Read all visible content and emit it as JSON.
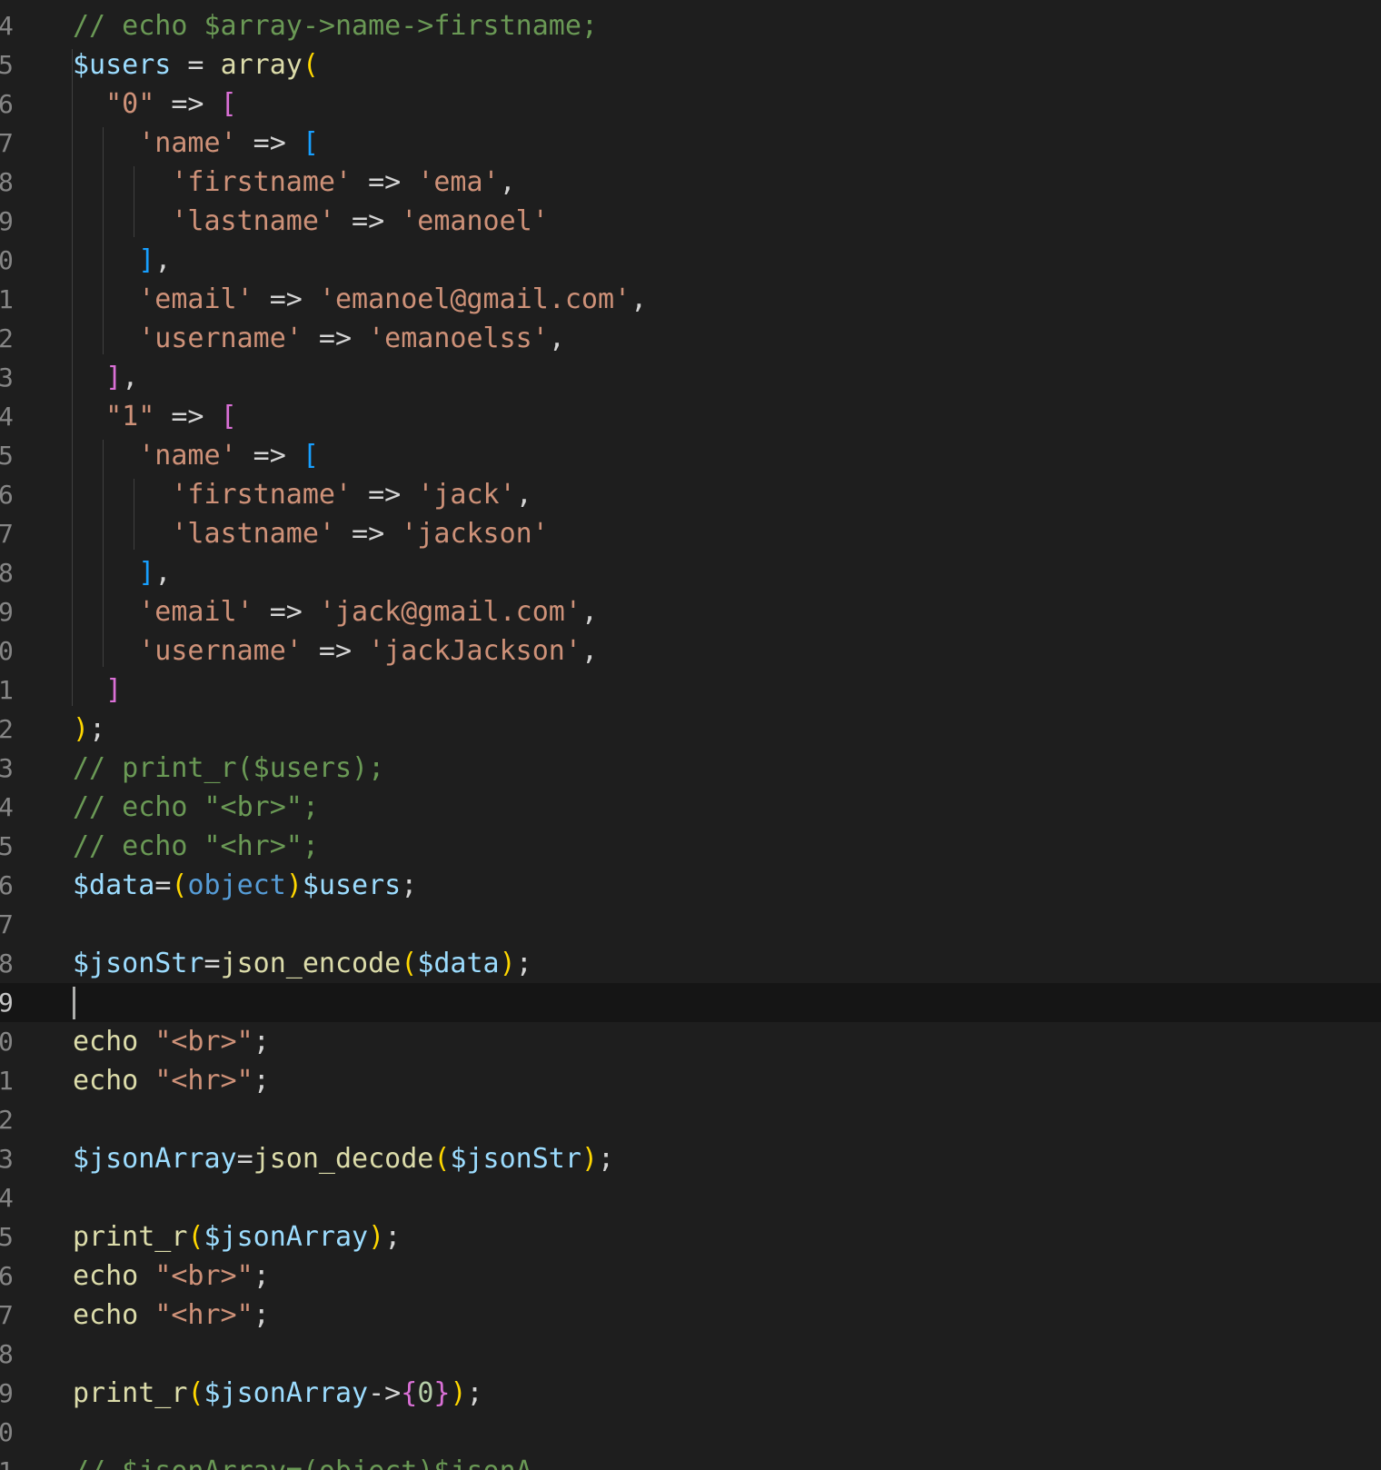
{
  "editor": {
    "colors": {
      "background": "#1e1e1e",
      "current_line": "#151515",
      "line_number": "#858585",
      "comment": "#6a9955",
      "variable": "#9cdcfe",
      "function": "#dcdcaa",
      "string": "#ce9178",
      "keyword": "#569cd6",
      "bracket_level1": "#ffd700",
      "bracket_level2": "#da70d6",
      "bracket_level3": "#179fff"
    },
    "current_line_number": "9",
    "lines": [
      {
        "n": "4",
        "tokens": [
          [
            "comment",
            "// echo $array->name->firstname;"
          ]
        ]
      },
      {
        "n": "5",
        "tokens": [
          [
            "var",
            "$users"
          ],
          [
            "op",
            " = "
          ],
          [
            "fn",
            "array"
          ],
          [
            "b1",
            "("
          ]
        ]
      },
      {
        "n": "6",
        "tokens": [
          [
            "plain",
            "  "
          ],
          [
            "str",
            "\"0\""
          ],
          [
            "op",
            " => "
          ],
          [
            "b2",
            "["
          ]
        ]
      },
      {
        "n": "7",
        "tokens": [
          [
            "plain",
            "    "
          ],
          [
            "str",
            "'name'"
          ],
          [
            "op",
            " => "
          ],
          [
            "b3",
            "["
          ]
        ]
      },
      {
        "n": "8",
        "tokens": [
          [
            "plain",
            "      "
          ],
          [
            "str",
            "'firstname'"
          ],
          [
            "op",
            " => "
          ],
          [
            "str",
            "'ema'"
          ],
          [
            "punc",
            ","
          ]
        ]
      },
      {
        "n": "9",
        "tokens": [
          [
            "plain",
            "      "
          ],
          [
            "str",
            "'lastname'"
          ],
          [
            "op",
            " => "
          ],
          [
            "str",
            "'emanoel'"
          ]
        ]
      },
      {
        "n": "0",
        "tokens": [
          [
            "plain",
            "    "
          ],
          [
            "b3",
            "]"
          ],
          [
            "punc",
            ","
          ]
        ]
      },
      {
        "n": "1",
        "tokens": [
          [
            "plain",
            "    "
          ],
          [
            "str",
            "'email'"
          ],
          [
            "op",
            " => "
          ],
          [
            "str",
            "'emanoel@gmail.com'"
          ],
          [
            "punc",
            ","
          ]
        ]
      },
      {
        "n": "2",
        "tokens": [
          [
            "plain",
            "    "
          ],
          [
            "str",
            "'username'"
          ],
          [
            "op",
            " => "
          ],
          [
            "str",
            "'emanoelss'"
          ],
          [
            "punc",
            ","
          ]
        ]
      },
      {
        "n": "3",
        "tokens": [
          [
            "plain",
            "  "
          ],
          [
            "b2",
            "]"
          ],
          [
            "punc",
            ","
          ]
        ]
      },
      {
        "n": "4",
        "tokens": [
          [
            "plain",
            "  "
          ],
          [
            "str",
            "\"1\""
          ],
          [
            "op",
            " => "
          ],
          [
            "b2",
            "["
          ]
        ]
      },
      {
        "n": "5",
        "tokens": [
          [
            "plain",
            "    "
          ],
          [
            "str",
            "'name'"
          ],
          [
            "op",
            " => "
          ],
          [
            "b3",
            "["
          ]
        ]
      },
      {
        "n": "6",
        "tokens": [
          [
            "plain",
            "      "
          ],
          [
            "str",
            "'firstname'"
          ],
          [
            "op",
            " => "
          ],
          [
            "str",
            "'jack'"
          ],
          [
            "punc",
            ","
          ]
        ]
      },
      {
        "n": "7",
        "tokens": [
          [
            "plain",
            "      "
          ],
          [
            "str",
            "'lastname'"
          ],
          [
            "op",
            " => "
          ],
          [
            "str",
            "'jackson'"
          ]
        ]
      },
      {
        "n": "8",
        "tokens": [
          [
            "plain",
            "    "
          ],
          [
            "b3",
            "]"
          ],
          [
            "punc",
            ","
          ]
        ]
      },
      {
        "n": "9",
        "tokens": [
          [
            "plain",
            "    "
          ],
          [
            "str",
            "'email'"
          ],
          [
            "op",
            " => "
          ],
          [
            "str",
            "'jack@gmail.com'"
          ],
          [
            "punc",
            ","
          ]
        ]
      },
      {
        "n": "0",
        "tokens": [
          [
            "plain",
            "    "
          ],
          [
            "str",
            "'username'"
          ],
          [
            "op",
            " => "
          ],
          [
            "str",
            "'jackJackson'"
          ],
          [
            "punc",
            ","
          ]
        ]
      },
      {
        "n": "1",
        "tokens": [
          [
            "plain",
            "  "
          ],
          [
            "b2",
            "]"
          ]
        ]
      },
      {
        "n": "2",
        "tokens": [
          [
            "b1",
            ")"
          ],
          [
            "punc",
            ";"
          ]
        ]
      },
      {
        "n": "3",
        "tokens": [
          [
            "comment",
            "// print_r($users);"
          ]
        ]
      },
      {
        "n": "4",
        "tokens": [
          [
            "comment",
            "// echo \"<br>\";"
          ]
        ]
      },
      {
        "n": "5",
        "tokens": [
          [
            "comment",
            "// echo \"<hr>\";"
          ]
        ]
      },
      {
        "n": "6",
        "tokens": [
          [
            "var",
            "$data"
          ],
          [
            "op",
            "="
          ],
          [
            "b1",
            "("
          ],
          [
            "kw",
            "object"
          ],
          [
            "b1",
            ")"
          ],
          [
            "var",
            "$users"
          ],
          [
            "punc",
            ";"
          ]
        ]
      },
      {
        "n": "7",
        "tokens": []
      },
      {
        "n": "8",
        "tokens": [
          [
            "var",
            "$jsonStr"
          ],
          [
            "op",
            "="
          ],
          [
            "fn",
            "json_encode"
          ],
          [
            "b1",
            "("
          ],
          [
            "var",
            "$data"
          ],
          [
            "b1",
            ")"
          ],
          [
            "punc",
            ";"
          ]
        ]
      },
      {
        "n": "9",
        "tokens": [],
        "current": true
      },
      {
        "n": "0",
        "tokens": [
          [
            "fn",
            "echo"
          ],
          [
            "plain",
            " "
          ],
          [
            "str",
            "\"<br>\""
          ],
          [
            "punc",
            ";"
          ]
        ]
      },
      {
        "n": "1",
        "tokens": [
          [
            "fn",
            "echo"
          ],
          [
            "plain",
            " "
          ],
          [
            "str",
            "\"<hr>\""
          ],
          [
            "punc",
            ";"
          ]
        ]
      },
      {
        "n": "2",
        "tokens": []
      },
      {
        "n": "3",
        "tokens": [
          [
            "var",
            "$jsonArray"
          ],
          [
            "op",
            "="
          ],
          [
            "fn",
            "json_decode"
          ],
          [
            "b1",
            "("
          ],
          [
            "var",
            "$jsonStr"
          ],
          [
            "b1",
            ")"
          ],
          [
            "punc",
            ";"
          ]
        ]
      },
      {
        "n": "4",
        "tokens": []
      },
      {
        "n": "5",
        "tokens": [
          [
            "fn",
            "print_r"
          ],
          [
            "b1",
            "("
          ],
          [
            "var",
            "$jsonArray"
          ],
          [
            "b1",
            ")"
          ],
          [
            "punc",
            ";"
          ]
        ]
      },
      {
        "n": "6",
        "tokens": [
          [
            "fn",
            "echo"
          ],
          [
            "plain",
            " "
          ],
          [
            "str",
            "\"<br>\""
          ],
          [
            "punc",
            ";"
          ]
        ]
      },
      {
        "n": "7",
        "tokens": [
          [
            "fn",
            "echo"
          ],
          [
            "plain",
            " "
          ],
          [
            "str",
            "\"<hr>\""
          ],
          [
            "punc",
            ";"
          ]
        ]
      },
      {
        "n": "8",
        "tokens": []
      },
      {
        "n": "9",
        "tokens": [
          [
            "fn",
            "print_r"
          ],
          [
            "b1",
            "("
          ],
          [
            "var",
            "$jsonArray"
          ],
          [
            "op",
            "->"
          ],
          [
            "b2",
            "{"
          ],
          [
            "num",
            "0"
          ],
          [
            "b2",
            "}"
          ],
          [
            "b1",
            ")"
          ],
          [
            "punc",
            ";"
          ]
        ]
      },
      {
        "n": "0",
        "tokens": []
      },
      {
        "n": "1",
        "tokens": [
          [
            "comment",
            "// $jsonArray=(object)$jsonA"
          ]
        ]
      }
    ]
  }
}
